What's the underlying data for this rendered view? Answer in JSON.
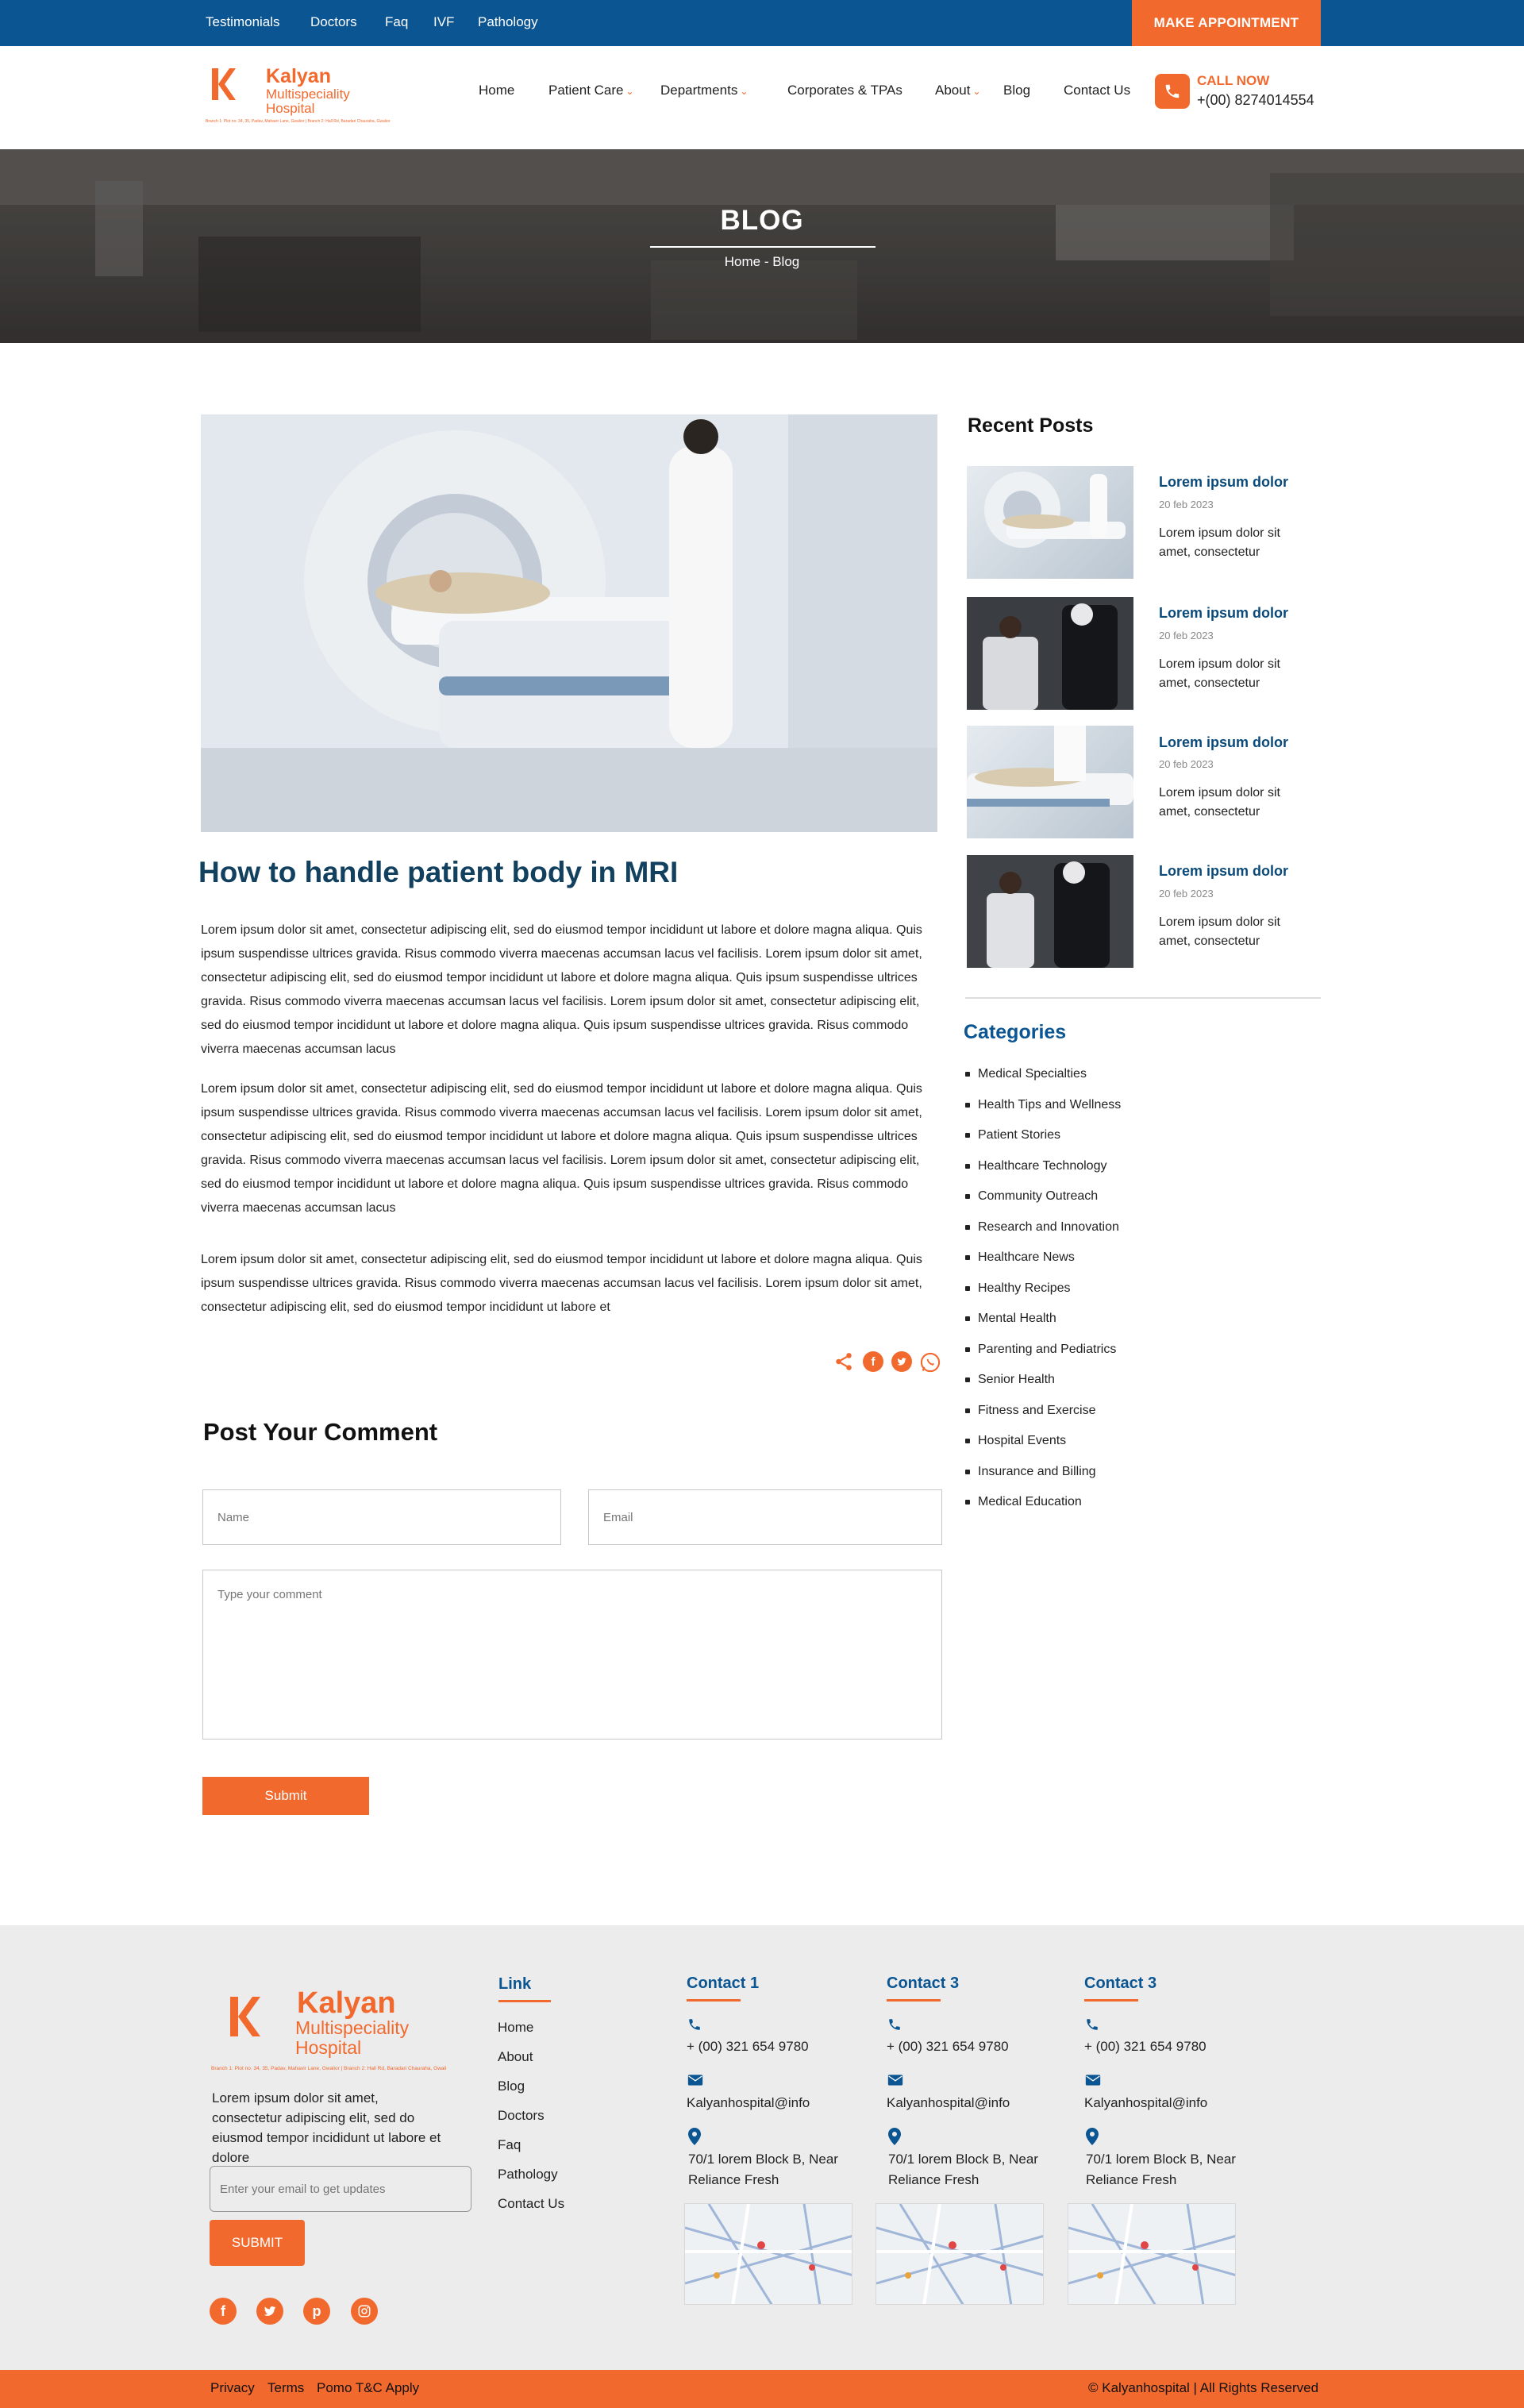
{
  "topbar": {
    "links": [
      "Testimonials",
      "Doctors",
      "Faq",
      "IVF",
      "Pathology"
    ],
    "cta": "MAKE APPOINTMENT"
  },
  "brand": {
    "name": "Kalyan",
    "sub1": "Multispeciality",
    "sub2": "Hospital",
    "address": "Branch 1: Plot no. 34, 35, Padav, Mahavir Lane, Gwalior | Branch 2: Hall Rd, Baradari Chauraha, Gwalior"
  },
  "nav": {
    "items": [
      "Home",
      "Patient Care",
      "Departments",
      "Corporates & TPAs",
      "About",
      "Blog",
      "Contact Us"
    ]
  },
  "call": {
    "label": "CALL NOW",
    "number": "+(00) 8274014554"
  },
  "hero": {
    "title": "BLOG",
    "breadcrumb": "Home - Blog"
  },
  "post": {
    "title": "How to handle patient body in MRI",
    "p1": "Lorem ipsum dolor sit amet, consectetur adipiscing elit, sed do eiusmod tempor incididunt ut labore et dolore magna aliqua. Quis ipsum suspendisse ultrices gravida. Risus commodo viverra maecenas accumsan lacus vel facilisis. Lorem ipsum dolor sit amet, consectetur adipiscing elit, sed do eiusmod tempor incididunt ut labore et dolore magna aliqua. Quis ipsum suspendisse ultrices gravida. Risus commodo viverra maecenas accumsan lacus vel facilisis. Lorem ipsum dolor sit amet, consectetur adipiscing elit, sed do eiusmod tempor incididunt ut labore et dolore magna aliqua. Quis ipsum suspendisse ultrices gravida. Risus commodo viverra maecenas accumsan lacus",
    "p2": "Lorem ipsum dolor sit amet, consectetur adipiscing elit, sed do eiusmod tempor incididunt ut labore et dolore magna aliqua. Quis ipsum suspendisse ultrices gravida. Risus commodo viverra maecenas accumsan lacus vel facilisis. Lorem ipsum dolor sit amet, consectetur adipiscing elit, sed do eiusmod tempor incididunt ut labore et dolore magna aliqua. Quis ipsum suspendisse ultrices gravida. Risus commodo viverra maecenas accumsan lacus vel facilisis. Lorem ipsum dolor sit amet, consectetur adipiscing elit, sed do eiusmod tempor incididunt ut labore et dolore magna aliqua. Quis ipsum suspendisse ultrices gravida. Risus commodo viverra maecenas accumsan lacus",
    "p3": "Lorem ipsum dolor sit amet, consectetur adipiscing elit, sed do eiusmod tempor incididunt ut labore et dolore magna aliqua. Quis ipsum suspendisse ultrices gravida. Risus commodo viverra maecenas accumsan lacus vel facilisis. Lorem ipsum dolor sit amet, consectetur adipiscing elit, sed do eiusmod tempor incididunt ut labore et"
  },
  "comment": {
    "title": "Post Your Comment",
    "name_ph": "Name",
    "email_ph": "Email",
    "comment_ph": "Type your comment",
    "submit": "Submit"
  },
  "sidebar": {
    "recent_title": "Recent Posts",
    "posts": [
      {
        "title": "Lorem ipsum dolor",
        "date": "20 feb 2023",
        "text": "Lorem ipsum dolor sit amet, consectetur"
      },
      {
        "title": "Lorem ipsum dolor",
        "date": "20 feb 2023",
        "text": "Lorem ipsum dolor sit amet, consectetur"
      },
      {
        "title": "Lorem ipsum dolor",
        "date": "20 feb 2023",
        "text": "Lorem ipsum dolor sit amet, consectetur"
      },
      {
        "title": "Lorem ipsum dolor",
        "date": "20 feb 2023",
        "text": "Lorem ipsum dolor sit amet, consectetur"
      }
    ],
    "categories_title": "Categories",
    "categories": [
      "Medical Specialties",
      "Health Tips and Wellness",
      "Patient Stories",
      "Healthcare Technology",
      "Community Outreach",
      "Research and Innovation",
      "Healthcare News",
      "Healthy Recipes",
      "Mental Health",
      "Parenting and Pediatrics",
      "Senior Health",
      "Fitness and Exercise",
      "Hospital Events",
      "Insurance and Billing",
      "Medical Education"
    ]
  },
  "footer": {
    "desc": "Lorem ipsum dolor sit amet, consectetur adipiscing elit, sed do eiusmod tempor incididunt ut labore et dolore",
    "email_ph": "Enter your email to get updates",
    "submit": "SUBMIT",
    "link_title": "Link",
    "links": [
      "Home",
      "About",
      "Blog",
      "Doctors",
      "Faq",
      "Pathology",
      "Contact Us"
    ],
    "contacts": [
      {
        "title": "Contact 1",
        "phone": "+ (00) 321 654 9780",
        "email": "Kalyanhospital@info",
        "addr1": "70/1 lorem Block B, Near",
        "addr2": "Reliance Fresh"
      },
      {
        "title": "Contact 3",
        "phone": "+ (00) 321 654 9780",
        "email": "Kalyanhospital@info",
        "addr1": "70/1 lorem Block B, Near",
        "addr2": "Reliance Fresh"
      },
      {
        "title": "Contact 3",
        "phone": "+ (00) 321 654 9780",
        "email": "Kalyanhospital@info",
        "addr1": "70/1 lorem Block B, Near",
        "addr2": "Reliance Fresh"
      }
    ],
    "bottom": {
      "privacy": "Privacy",
      "terms": "Terms",
      "pomo": "Pomo T&C Apply",
      "copyright": "© Kalyanhospital | All Rights Reserved"
    }
  },
  "colors": {
    "primary": "#0a5592",
    "accent": "#f2692d",
    "title": "#12405f"
  }
}
